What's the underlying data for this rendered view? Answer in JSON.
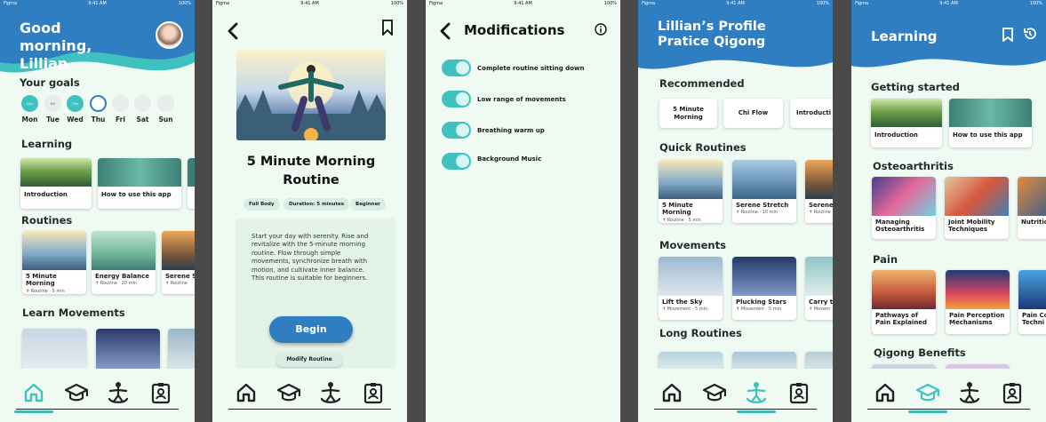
{
  "status": {
    "carrier": "Figma",
    "time": "9:41 AM",
    "battery": "100%"
  },
  "home": {
    "greeting": "Good morning, Lillian",
    "goals_title": "Your goals",
    "goal_values": [
      "20m",
      "8m",
      "15m"
    ],
    "days": [
      "Mon",
      "Tue",
      "Wed",
      "Thu",
      "Fri",
      "Sat",
      "Sun"
    ],
    "learning_title": "Learning",
    "learning_cards": [
      "Introduction",
      "How to use this app"
    ],
    "routines_title": "Routines",
    "routines": [
      {
        "title": "5 Minute Morning",
        "sub": "Routine · 5 min"
      },
      {
        "title": "Energy Balance",
        "sub": "Routine · 20 min"
      },
      {
        "title": "Serene S",
        "sub": "Routine"
      }
    ],
    "movements_title": "Learn Movements"
  },
  "detail": {
    "title": "5 Minute Morning Routine",
    "chips": [
      "Full Body",
      "Duration: 5 minutes",
      "Beginner"
    ],
    "description": "Start your day with serenity. Rise and revitalize with the 5-minute morning routine. Flow through simple movements, synchronize breath with motion, and cultivate inner balance. This routine is suitable for beginners.",
    "begin": "Begin",
    "modify": "Modify Routine"
  },
  "mods": {
    "title": "Modifications",
    "options": [
      "Complete routine sitting down",
      "Low range of movements",
      "Breathing warm up",
      "Background Music"
    ]
  },
  "profile": {
    "title_line1": "Lillian’s Profile",
    "title_line2": "Pratice Qigong",
    "recommended_title": "Recommended",
    "recommended": [
      "5 Minute Morning",
      "Chi Flow",
      "Introducti"
    ],
    "quick_title": "Quick Routines",
    "quick": [
      {
        "title": "5 Minute Morning",
        "sub": "Routine · 5 min"
      },
      {
        "title": "Serene Stretch",
        "sub": "Routine · 10 min"
      },
      {
        "title": "Serene",
        "sub": "Routine"
      }
    ],
    "movements_title": "Movements",
    "movements": [
      {
        "title": "Lift the Sky",
        "sub": "Movement · 5 min"
      },
      {
        "title": "Plucking Stars",
        "sub": "Movement · 5 min"
      },
      {
        "title": "Carry t",
        "sub": "Movem"
      }
    ],
    "long_title": "Long Routines"
  },
  "learning": {
    "title": "Learning",
    "getting_started": "Getting started",
    "gs_cards": [
      "Introduction",
      "How to use this app"
    ],
    "osteo_title": "Osteoarthritis",
    "osteo_cards": [
      "Managing Osteoarthritis",
      "Joint Mobility Techniques",
      "Nutritio"
    ],
    "pain_title": "Pain",
    "pain_cards": [
      "Pathways of Pain Explained",
      "Pain Perception Mechanisms",
      "Pain Co Techni"
    ],
    "benefits_title": "Qigong Benefits"
  },
  "colors": {
    "accent": "#3fc1c0",
    "brand": "#2f7ec1",
    "background": "#eefaf2"
  }
}
